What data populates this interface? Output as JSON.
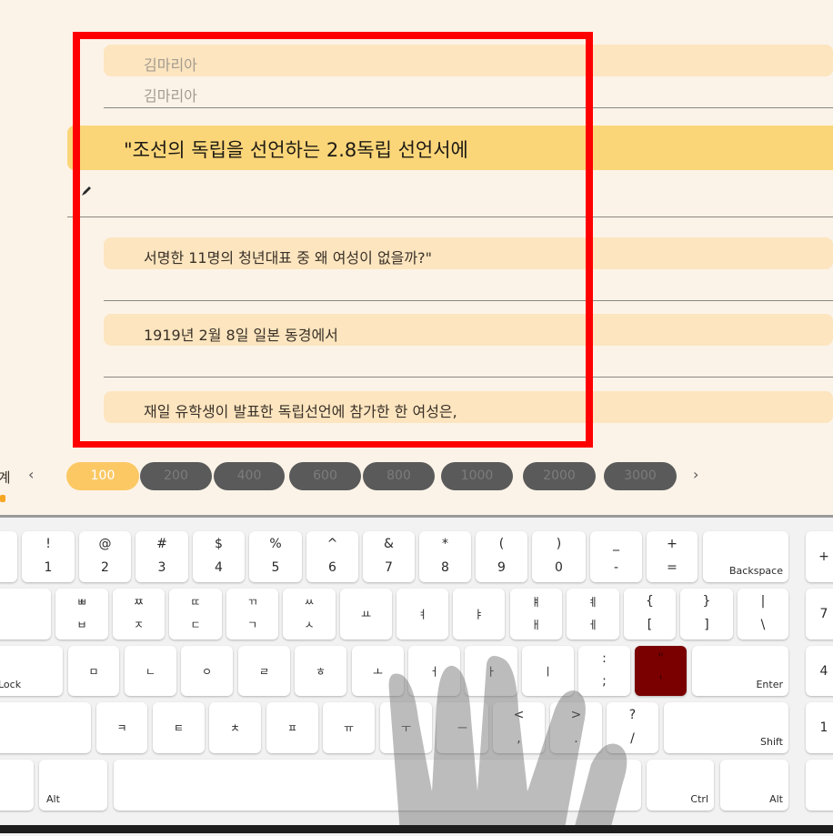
{
  "transcript": {
    "lines": [
      {
        "text": "김마리아"
      },
      {
        "text": "김마리아"
      },
      {
        "text": "\"조선의 독립을 선언하는 2.8독립 선언서에"
      },
      {
        "text": "서명한 11명의 청년대표 중 왜 여성이 없을까?\""
      },
      {
        "text": "1919년 2월 8일 일본 동경에서"
      },
      {
        "text": "재일 유학생이 발표한 독립선언에 참가한 한 여성은,"
      }
    ]
  },
  "zoom": {
    "left_label": "단계",
    "options": [
      "100",
      "200",
      "400",
      "600",
      "800",
      "1000",
      "2000",
      "3000"
    ],
    "selected": "100"
  },
  "keyboard": {
    "row1": [
      {
        "top": "!",
        "bot": "1"
      },
      {
        "top": "@",
        "bot": "2"
      },
      {
        "top": "#",
        "bot": "3"
      },
      {
        "top": "$",
        "bot": "4"
      },
      {
        "top": "%",
        "bot": "5"
      },
      {
        "top": "^",
        "bot": "6"
      },
      {
        "top": "&",
        "bot": "7"
      },
      {
        "top": "*",
        "bot": "8"
      },
      {
        "top": "(",
        "bot": "9"
      },
      {
        "top": ")",
        "bot": "0"
      },
      {
        "top": "_",
        "bot": "-"
      },
      {
        "top": "+",
        "bot": "="
      }
    ],
    "backspace": "Backspace",
    "row2": [
      {
        "top": "ㅃ",
        "bot": "ㅂ"
      },
      {
        "top": "ㅉ",
        "bot": "ㅈ"
      },
      {
        "top": "ㄸ",
        "bot": "ㄷ"
      },
      {
        "top": "ㄲ",
        "bot": "ㄱ"
      },
      {
        "top": "ㅆ",
        "bot": "ㅅ"
      },
      {
        "top": "",
        "bot": "ㅛ"
      },
      {
        "top": "",
        "bot": "ㅕ"
      },
      {
        "top": "",
        "bot": "ㅑ"
      },
      {
        "top": "ㅒ",
        "bot": "ㅐ"
      },
      {
        "top": "ㅖ",
        "bot": "ㅔ"
      },
      {
        "top": "{",
        "bot": "["
      },
      {
        "top": "}",
        "bot": "]"
      },
      {
        "top": "|",
        "bot": "\\"
      }
    ],
    "row3_lock": "Lock",
    "row3": [
      "ㅁ",
      "ㄴ",
      "ㅇ",
      "ㄹ",
      "ㅎ",
      "ㅗ",
      "ㅓ",
      "ㅏ",
      "ㅣ"
    ],
    "row3_semicolon": {
      "top": ":",
      "bot": ";"
    },
    "row3_quote": {
      "top": "\"",
      "bot": "'"
    },
    "enter": "Enter",
    "row4": [
      "ㅋ",
      "ㅌ",
      "ㅊ",
      "ㅍ",
      "ㅠ",
      "ㅜ",
      "ㅡ"
    ],
    "row4_punct": [
      {
        "top": "<",
        "bot": ","
      },
      {
        "top": ">",
        "bot": "."
      },
      {
        "top": "?",
        "bot": "/"
      }
    ],
    "shift": "Shift",
    "alt_left": "Alt",
    "ctrl": "Ctrl",
    "alt_right": "Alt",
    "numpad": [
      "+",
      "7",
      "4",
      "1"
    ],
    "pressed_color": "#7a0000",
    "highlight_color": "#fbd679",
    "frame_color": "#ff0000"
  }
}
